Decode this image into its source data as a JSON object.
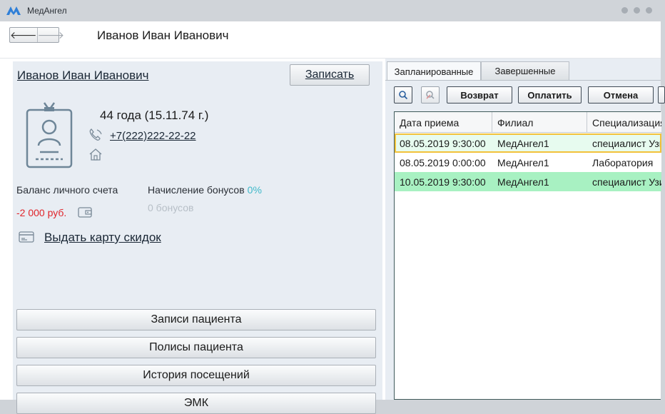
{
  "app": {
    "title": "МедАнгел"
  },
  "header": {
    "back": "🡐",
    "forward": "🡒",
    "title": "Иванов Иван Иванович"
  },
  "patient": {
    "name": "Иванов Иван Иванович",
    "record_button": "Записать",
    "age": "44 года  (15.11.74 г.)",
    "phone": "+7(222)222-22-22",
    "balance_label": "Баланс личного счета",
    "balance_value": "-2 000 руб.",
    "bonus_label": "Начисление бонусов",
    "bonus_percent": "0%",
    "bonus_value": "0 бонусов",
    "card_link": "Выдать карту скидок"
  },
  "actions": [
    "Записи пациента",
    "Полисы пациента",
    "История посещений",
    "ЭМК"
  ],
  "tabs": {
    "planned": "Запланированные",
    "completed": "Завершенные"
  },
  "toolbar": {
    "return": "Возврат",
    "pay": "Оплатить",
    "cancel": "Отмена"
  },
  "table": {
    "columns": [
      "Дата приема",
      "Филиал",
      "Специализация"
    ],
    "rows": [
      {
        "date": "08.05.2019 9:30:00",
        "branch": "МедАнгел1",
        "spec": "специалист Узи",
        "bg": "#e7fbef",
        "selected": true
      },
      {
        "date": "08.05.2019 0:00:00",
        "branch": "МедАнгел1",
        "spec": "Лаборатория",
        "bg": "#ffffff",
        "selected": false
      },
      {
        "date": "10.05.2019 9:30:00",
        "branch": "МедАнгел1",
        "spec": "специалист Узи",
        "bg": "#a8f1c2",
        "selected": false
      }
    ]
  },
  "colors": {
    "accent": "#2f7fd8",
    "negative": "#e0252b",
    "bonus": "#3fb8c9",
    "selection_border": "#f2c23a"
  }
}
